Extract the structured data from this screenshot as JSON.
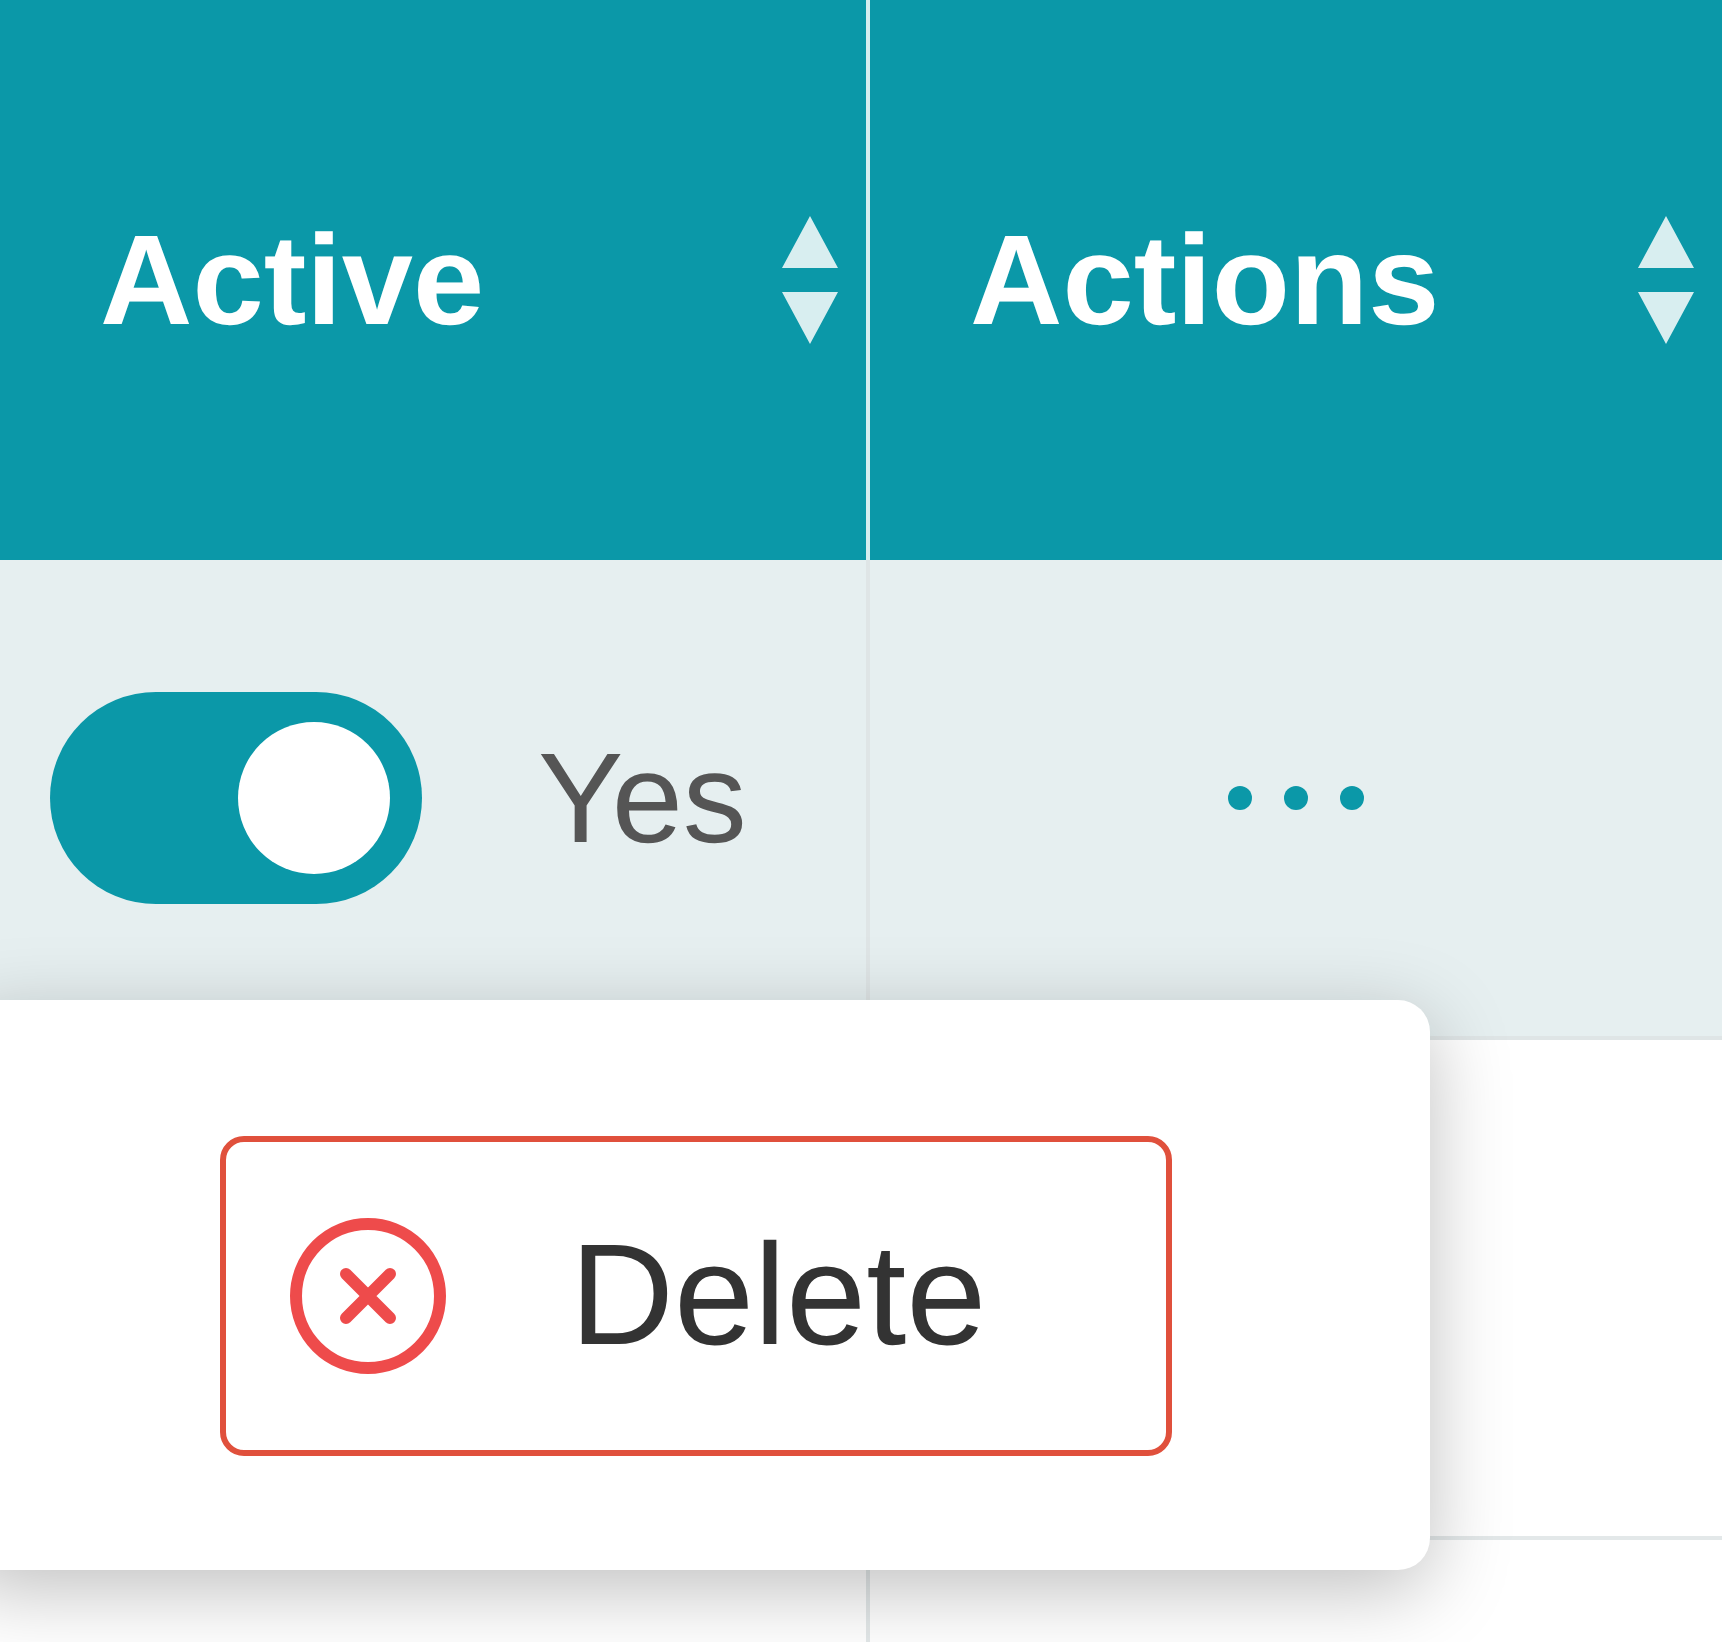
{
  "table": {
    "columns": [
      {
        "label": "Active"
      },
      {
        "label": "Actions"
      }
    ],
    "rows": [
      {
        "active": {
          "on": true,
          "label": "Yes"
        }
      }
    ]
  },
  "menu": {
    "items": [
      {
        "label": "Delete",
        "kind": "danger",
        "selected": true
      }
    ]
  }
}
